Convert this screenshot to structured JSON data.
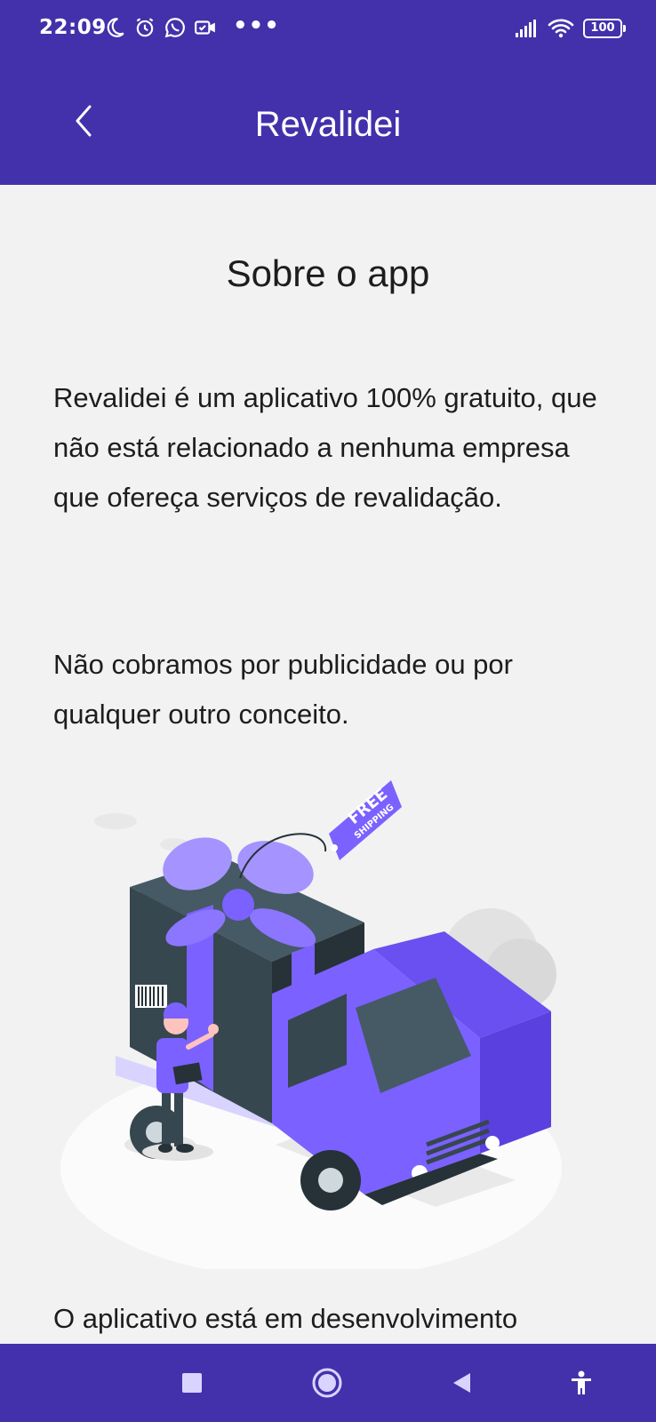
{
  "status_bar": {
    "time": "22:09",
    "left_icons": [
      "moon-icon",
      "alarm-icon",
      "whatsapp-icon",
      "video-icon"
    ],
    "more": "•••",
    "battery": "100",
    "right_icons": [
      "signal-icon",
      "wifi-icon",
      "battery-icon"
    ]
  },
  "app_bar": {
    "title": "Revalidei",
    "back_icon": "chevron-left-icon"
  },
  "content": {
    "section_title": "Sobre o app",
    "paragraph_1": "Revalidei é um aplicativo 100% gratuito, que não está relacionado a nenhuma empresa que ofereça serviços de revalidação.",
    "paragraph_2": "Não cobramos por publicidade ou por qualquer outro conceito.",
    "paragraph_3": "O aplicativo está em desenvolvimento",
    "illustration": {
      "tag_text_1": "FREE",
      "tag_text_2": "SHIPPING"
    }
  },
  "nav_bar": {
    "items": [
      "recents-square-icon",
      "home-circle-icon",
      "back-triangle-icon",
      "accessibility-icon"
    ]
  },
  "colors": {
    "primary": "#4231ab",
    "accent": "#7b61ff",
    "background": "#f2f2f2",
    "text": "#1d1d1d"
  }
}
